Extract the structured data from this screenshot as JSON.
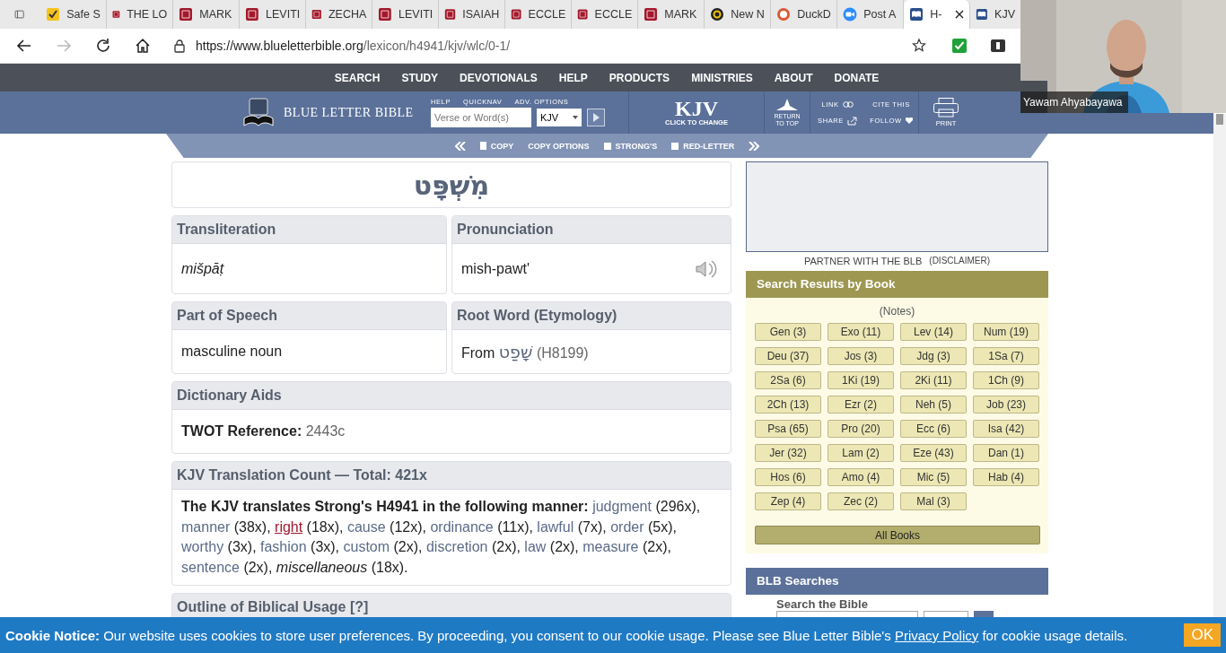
{
  "browser": {
    "tabs": [
      {
        "title": "Safe S",
        "kind": "check",
        "selected": false
      },
      {
        "title": "THE LO",
        "kind": "book",
        "selected": false
      },
      {
        "title": "MARK",
        "kind": "book",
        "selected": false
      },
      {
        "title": "LEVITI",
        "kind": "book",
        "selected": false
      },
      {
        "title": "ZECHA",
        "kind": "book",
        "selected": false
      },
      {
        "title": "LEVITI",
        "kind": "book",
        "selected": false
      },
      {
        "title": "ISAIAH",
        "kind": "book",
        "selected": false
      },
      {
        "title": "ECCLE",
        "kind": "book",
        "selected": false
      },
      {
        "title": "ECCLE",
        "kind": "book",
        "selected": false
      },
      {
        "title": "MARK",
        "kind": "book",
        "selected": false
      },
      {
        "title": "New N",
        "kind": "news",
        "selected": false
      },
      {
        "title": "DuckD",
        "kind": "duck",
        "selected": false
      },
      {
        "title": "Post A",
        "kind": "video",
        "selected": false
      },
      {
        "title": "H-",
        "kind": "blb",
        "selected": true
      },
      {
        "title": "KJV",
        "kind": "blb",
        "selected": false
      }
    ],
    "url_host": "https://www.blueletterbible.org",
    "url_path": "/lexicon/h4941/kjv/wlc/0-1/"
  },
  "site_nav": [
    "SEARCH",
    "STUDY",
    "DEVOTIONALS",
    "HELP",
    "PRODUCTS",
    "MINISTRIES",
    "ABOUT",
    "DONATE"
  ],
  "header": {
    "logo": "BLUE LETTER BIBLE",
    "quick_labels": [
      "HELP",
      "QUICKNAV",
      "ADV. OPTIONS"
    ],
    "search_placeholder": "Verse or Word(s)",
    "version_select": "KJV",
    "version": "KJV",
    "version_hint": "CLICK TO CHANGE",
    "return_top": "RETURN TO TOP",
    "link": "LINK",
    "share": "SHARE",
    "cite": "CITE THIS",
    "follow": "FOLLOW",
    "print": "PRINT"
  },
  "toolbar": {
    "actions": [
      "COPY",
      "COPY OPTIONS"
    ],
    "toggles": [
      {
        "label": "STRONG'S",
        "checked": false
      },
      {
        "label": "RED-LETTER",
        "checked": false
      }
    ]
  },
  "word": "מִשְׁפָּט",
  "fields": [
    {
      "heading": "Transliteration",
      "kind": "italic",
      "value": "mišpāṭ"
    },
    {
      "heading": "Pronunciation",
      "kind": "audio",
      "value": "mish-pawt'"
    },
    {
      "heading": "Part of Speech",
      "kind": "plain",
      "value": "masculine noun"
    },
    {
      "heading": "Root Word (Etymology)",
      "kind": "root",
      "value": "From",
      "hebrew": "שָׁפַט",
      "ref": "(H8199)"
    }
  ],
  "dictionary_aids": {
    "heading": "Dictionary Aids",
    "label": "TWOT Reference:",
    "value": "2443c"
  },
  "translation_count": {
    "heading": "KJV Translation Count — Total: 421x",
    "intro": "The KJV translates Strong's H4941 in the following manner:",
    "items": [
      {
        "word": "judgment",
        "count": "(296x),",
        "kind": "link",
        "hovered": false
      },
      {
        "word": "manner",
        "count": "(38x),",
        "kind": "link",
        "hovered": false
      },
      {
        "word": "right",
        "count": "(18x),",
        "kind": "link",
        "hovered": true
      },
      {
        "word": "cause",
        "count": "(12x),",
        "kind": "link",
        "hovered": false
      },
      {
        "word": "ordinance",
        "count": "(11x),",
        "kind": "link",
        "hovered": false
      },
      {
        "word": "lawful",
        "count": "(7x),",
        "kind": "link",
        "hovered": false
      },
      {
        "word": "order",
        "count": "(5x),",
        "kind": "link",
        "hovered": false
      },
      {
        "word": "worthy",
        "count": "(3x),",
        "kind": "link",
        "hovered": false
      },
      {
        "word": "fashion",
        "count": "(3x),",
        "kind": "link",
        "hovered": false
      },
      {
        "word": "custom",
        "count": "(2x),",
        "kind": "link",
        "hovered": false
      },
      {
        "word": "discretion",
        "count": "(2x),",
        "kind": "link",
        "hovered": false
      },
      {
        "word": "law",
        "count": "(2x),",
        "kind": "link",
        "hovered": false
      },
      {
        "word": "measure",
        "count": "(2x),",
        "kind": "link",
        "hovered": false
      },
      {
        "word": "sentence",
        "count": "(2x),",
        "kind": "link",
        "hovered": false
      },
      {
        "word": "miscellaneous",
        "count": "(18x).",
        "kind": "other",
        "hovered": false
      }
    ]
  },
  "outline_heading": "Outline of Biblical Usage [?]",
  "ad": {
    "partner": "PARTNER WITH THE BLB",
    "disclaimer": "(DISCLAIMER)"
  },
  "book_results": {
    "heading": "Search Results by Book",
    "notes": "(Notes)",
    "books": [
      "Gen (3)",
      "Exo (11)",
      "Lev (14)",
      "Num (19)",
      "Deu (37)",
      "Jos (3)",
      "Jdg (3)",
      "1Sa (7)",
      "2Sa (6)",
      "1Ki (19)",
      "2Ki (11)",
      "1Ch (9)",
      "2Ch (13)",
      "Ezr (2)",
      "Neh (5)",
      "Job (23)",
      "Psa (65)",
      "Pro (20)",
      "Ecc (6)",
      "Isa (42)",
      "Jer (32)",
      "Lam (2)",
      "Eze (43)",
      "Dan (1)",
      "Hos (6)",
      "Amo (4)",
      "Mic (5)",
      "Hab (4)",
      "Zep (4)",
      "Zec (2)",
      "Mal (3)"
    ],
    "all": "All Books"
  },
  "blb_searches": {
    "heading": "BLB Searches",
    "label": "Search the Bible"
  },
  "cookie": {
    "title": "Cookie Notice:",
    "text_before": "Our website uses cookies to store user preferences. By proceeding, you consent to our cookie usage. Please see Blue Letter Bible's",
    "link": "Privacy Policy",
    "text_after": "for cookie usage details.",
    "ok": "OK"
  },
  "video": {
    "name": "Yawam Ahyabayawa"
  }
}
